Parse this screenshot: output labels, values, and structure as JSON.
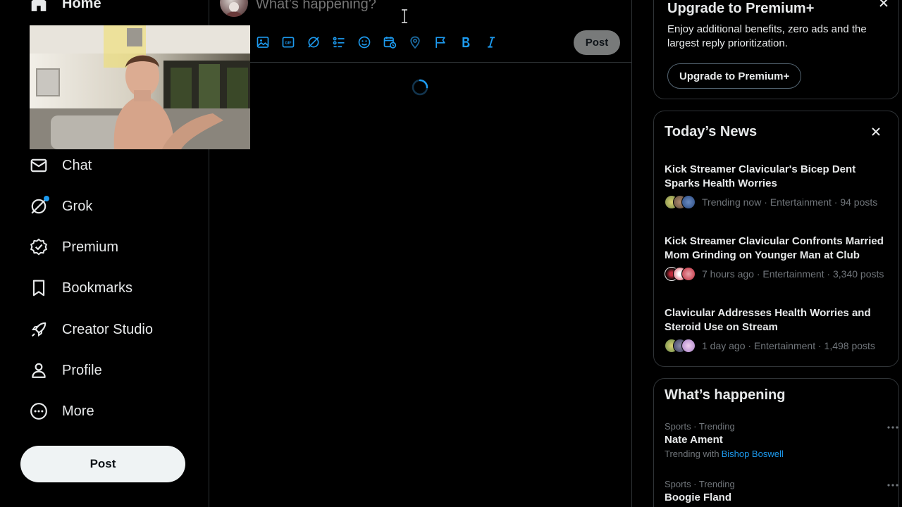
{
  "sidebar": {
    "items": [
      {
        "label": "Home",
        "icon": "home-icon"
      },
      {
        "label": "Chat",
        "icon": "mail-icon"
      },
      {
        "label": "Grok",
        "icon": "grok-icon"
      },
      {
        "label": "Premium",
        "icon": "verified-badge-icon"
      },
      {
        "label": "Bookmarks",
        "icon": "bookmark-icon"
      },
      {
        "label": "Creator Studio",
        "icon": "rocket-icon"
      },
      {
        "label": "Profile",
        "icon": "person-icon"
      },
      {
        "label": "More",
        "icon": "more-circle-icon"
      }
    ],
    "post_label": "Post"
  },
  "composer": {
    "placeholder": "What’s happening?",
    "post_label": "Post",
    "tools": [
      "image-icon",
      "gif-icon",
      "grok-icon",
      "poll-icon",
      "emoji-icon",
      "schedule-icon",
      "location-icon",
      "flag-icon",
      "bold-icon",
      "italic-icon"
    ]
  },
  "premium": {
    "title": "Upgrade to Premium+",
    "description": "Enjoy additional benefits, zero ads and the largest reply prioritization.",
    "button_label": "Upgrade to Premium+"
  },
  "news": {
    "title": "Today’s News",
    "items": [
      {
        "headline": "Kick Streamer Clavicular's Bicep Dent Sparks Health Worries",
        "meta": "Trending now · Entertainment · 94 posts",
        "avatar_colors": [
          "#8a9a5b",
          "#a0826d",
          "#3a5fa0"
        ]
      },
      {
        "headline": "Kick Streamer Clavicular Confronts Married Mom Grinding on Younger Man at Club",
        "meta": "7 hours ago · Entertainment · 3,340 posts",
        "avatar_colors": [
          "#2a1a1a",
          "#d94a5a",
          "#c02a3a"
        ]
      },
      {
        "headline": "Clavicular Addresses Health Worries and Steroid Use on Stream",
        "meta": "1 day ago · Entertainment · 1,498 posts",
        "avatar_colors": [
          "#7a9a4b",
          "#6a6a8a",
          "#c8a8d8"
        ]
      }
    ]
  },
  "happening": {
    "title": "What’s happening",
    "trends": [
      {
        "context": "Sports · Trending",
        "name": "Nate Ament",
        "with_label": "Trending with",
        "with_link": "Bishop Boswell"
      },
      {
        "context": "Sports · Trending",
        "name": "Boogie Fland"
      }
    ]
  },
  "colors": {
    "accent": "#1d9bf0",
    "background": "#000000",
    "border": "#2f3336",
    "muted_text": "#71767b"
  }
}
